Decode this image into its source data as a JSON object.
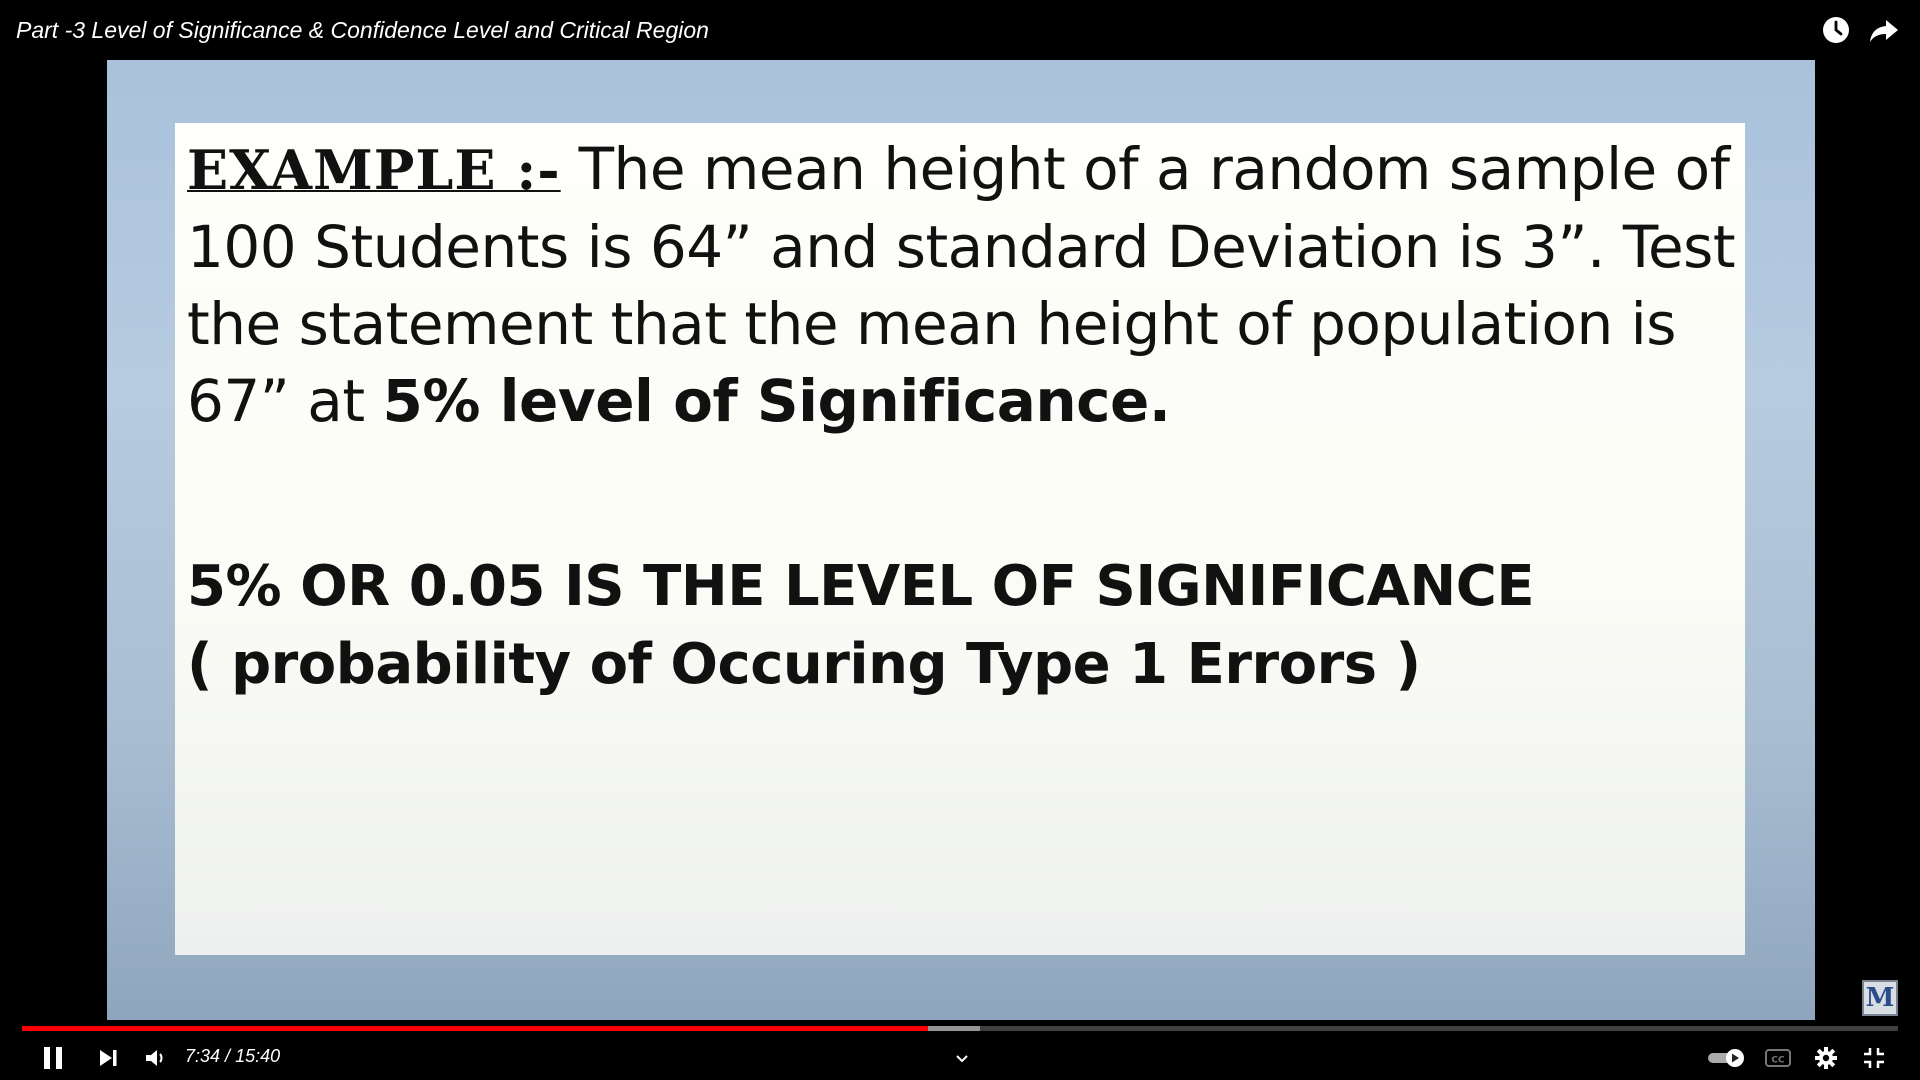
{
  "player": {
    "title": "Part -3 Level of Significance & Confidence Level and Critical Region",
    "time_current": "7:34",
    "time_separator": " / ",
    "time_total": "15:40",
    "progress_played_fraction": 0.483,
    "progress_buffered_fraction": 0.5105,
    "accent_color": "#ff0000"
  },
  "slide": {
    "example_label": "EXAMPLE :-",
    "line1_rest": " The mean height of a random sample of",
    "line2": "100 Students is 64” and standard Deviation is 3”. Test",
    "line3": "the statement that the mean height of population is",
    "line4_plain": "67” at ",
    "line4_bold": "5% level of Significance.",
    "heading1": "5% OR 0.05 IS THE LEVEL OF SIGNIFICANCE",
    "heading2": "( probability of Occuring Type 1 Errors )"
  },
  "icons": {
    "top": [
      "watch-later-icon",
      "share-icon"
    ],
    "controls": [
      "pause-icon",
      "next-icon",
      "volume-icon",
      "chevron-down-icon",
      "autoplay-toggle-icon",
      "captions-icon",
      "settings-icon",
      "exit-fullscreen-icon"
    ],
    "channel_logo": "M"
  }
}
